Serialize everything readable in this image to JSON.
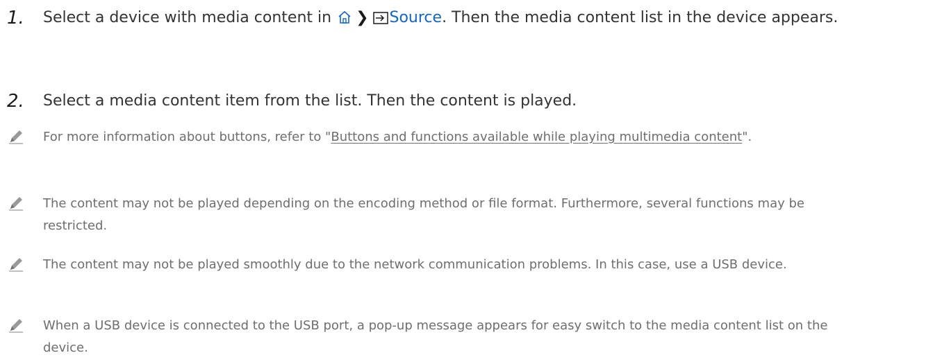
{
  "steps": [
    {
      "number": "1.",
      "text_before": "Select a device with media content in ",
      "separator": "❯",
      "link": "Source",
      "text_after": ". Then the media content list in the device appears."
    },
    {
      "number": "2.",
      "text": "Select a media content item from the list. Then the content is played."
    }
  ],
  "notes": [
    {
      "before": "For more information about buttons, refer to \"",
      "link": "Buttons and functions available while playing multimedia content",
      "after": "\"."
    },
    {
      "text": "The content may not be played depending on the encoding method or file format. Furthermore, several functions may be restricted."
    },
    {
      "text": "The content may not be played smoothly due to the network communication problems. In this case, use a USB device."
    },
    {
      "text": "When a USB device is connected to the USB port, a pop-up message appears for easy switch to the media content list on the device."
    }
  ],
  "icons": {
    "home": "home-icon",
    "source": "source-icon",
    "note": "pencil-icon"
  },
  "colors": {
    "link": "#1565c0",
    "note_text": "#6e6e6e",
    "body_text": "#333333"
  }
}
